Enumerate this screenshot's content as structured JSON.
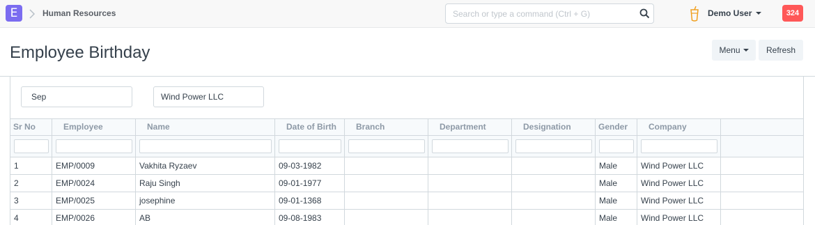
{
  "navbar": {
    "logo_letter": "E",
    "breadcrumb": "Human Resources",
    "search_placeholder": "Search or type a command (Ctrl + G)",
    "user_name": "Demo User",
    "notification_count": "324"
  },
  "page": {
    "title": "Employee Birthday",
    "menu_label": "Menu",
    "refresh_label": "Refresh"
  },
  "filters": {
    "month": "Sep",
    "company": "Wind Power LLC"
  },
  "table": {
    "columns": [
      "Sr No",
      "Employee",
      "Name",
      "Date of Birth",
      "Branch",
      "Department",
      "Designation",
      "Gender",
      "Company"
    ],
    "rows": [
      {
        "sr": "1",
        "employee": "EMP/0009",
        "name": "Vakhita Ryzaev",
        "dob": "09-03-1982",
        "branch": "",
        "department": "",
        "designation": "",
        "gender": "Male",
        "company": "Wind Power LLC"
      },
      {
        "sr": "2",
        "employee": "EMP/0024",
        "name": "Raju Singh",
        "dob": "09-01-1977",
        "branch": "",
        "department": "",
        "designation": "",
        "gender": "Male",
        "company": "Wind Power LLC"
      },
      {
        "sr": "3",
        "employee": "EMP/0025",
        "name": "josephine",
        "dob": "09-01-1368",
        "branch": "",
        "department": "",
        "designation": "",
        "gender": "Male",
        "company": "Wind Power LLC"
      },
      {
        "sr": "4",
        "employee": "EMP/0026",
        "name": "AB",
        "dob": "09-08-1983",
        "branch": "",
        "department": "",
        "designation": "",
        "gender": "Male",
        "company": "Wind Power LLC"
      }
    ]
  },
  "colors": {
    "logo_bg": "#7b6cf0",
    "notification_bg": "#ff5858",
    "user_icon": "#f0a020"
  }
}
